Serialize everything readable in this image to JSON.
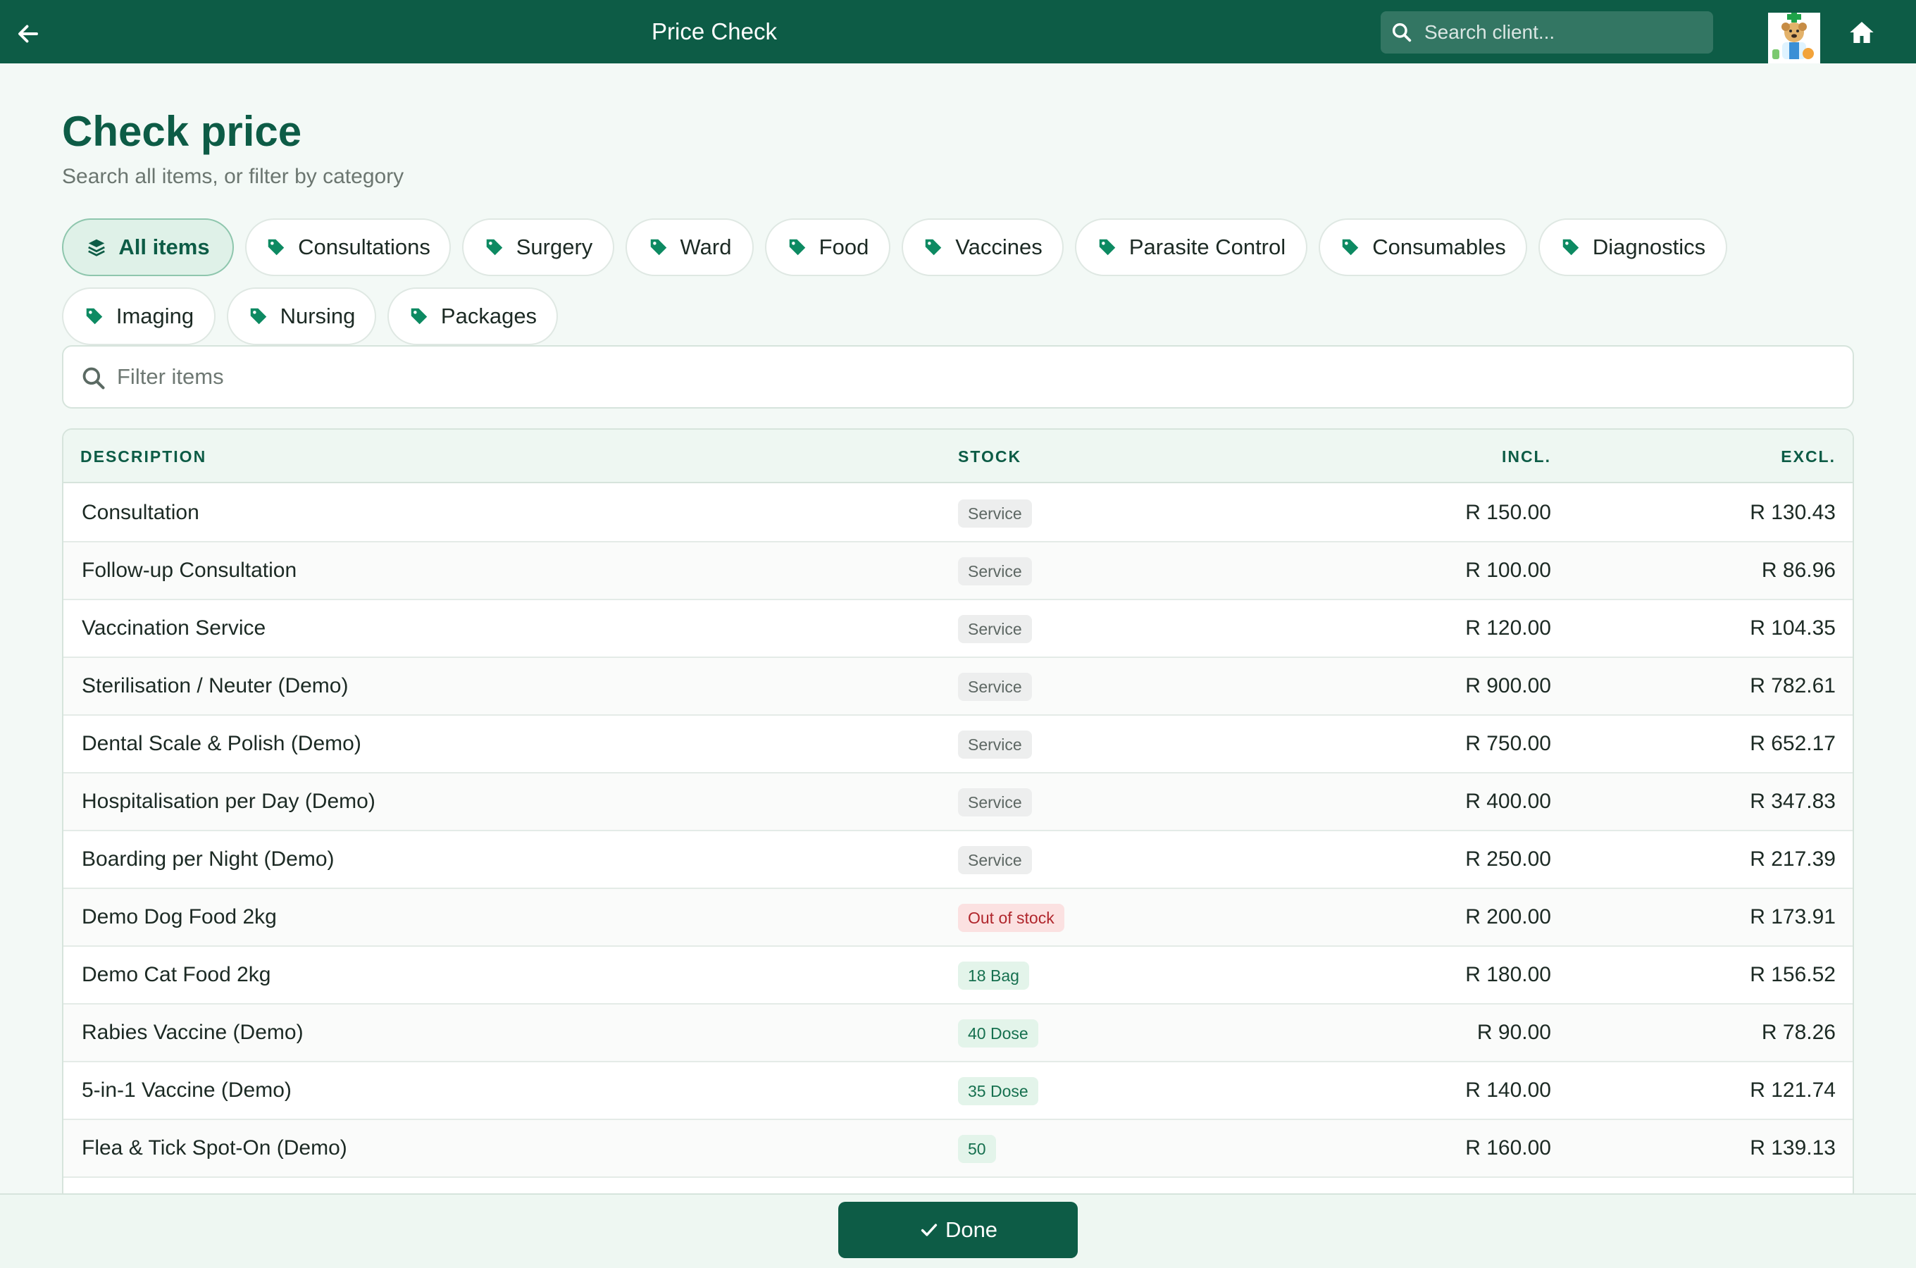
{
  "header": {
    "title": "Price Check",
    "search_placeholder": "Search client...",
    "back_icon": "arrow-left-icon",
    "home_icon": "home-icon",
    "brand_color": "#0d5c46"
  },
  "page": {
    "title": "Check price",
    "subtitle": "Search all items, or filter by category"
  },
  "categories": [
    {
      "label": "All items",
      "icon": "layers-icon",
      "active": true
    },
    {
      "label": "Consultations",
      "icon": "tag-icon"
    },
    {
      "label": "Surgery",
      "icon": "tag-icon"
    },
    {
      "label": "Ward",
      "icon": "tag-icon"
    },
    {
      "label": "Food",
      "icon": "tag-icon"
    },
    {
      "label": "Vaccines",
      "icon": "tag-icon"
    },
    {
      "label": "Parasite Control",
      "icon": "tag-icon"
    },
    {
      "label": "Consumables",
      "icon": "tag-icon"
    },
    {
      "label": "Diagnostics",
      "icon": "tag-icon"
    },
    {
      "label": "Imaging",
      "icon": "tag-icon"
    },
    {
      "label": "Nursing",
      "icon": "tag-icon"
    },
    {
      "label": "Packages",
      "icon": "tag-icon"
    }
  ],
  "filter": {
    "placeholder": "Filter items",
    "value": ""
  },
  "table": {
    "columns": {
      "description": "DESCRIPTION",
      "stock": "STOCK",
      "incl": "INCL.",
      "excl": "EXCL."
    },
    "rows": [
      {
        "description": "Consultation",
        "stock": "Service",
        "stock_status": "neutral",
        "incl": "R 150.00",
        "excl": "R 130.43"
      },
      {
        "description": "Follow-up Consultation",
        "stock": "Service",
        "stock_status": "neutral",
        "incl": "R 100.00",
        "excl": "R 86.96"
      },
      {
        "description": "Vaccination Service",
        "stock": "Service",
        "stock_status": "neutral",
        "incl": "R 120.00",
        "excl": "R 104.35"
      },
      {
        "description": "Sterilisation / Neuter (Demo)",
        "stock": "Service",
        "stock_status": "neutral",
        "incl": "R 900.00",
        "excl": "R 782.61"
      },
      {
        "description": "Dental Scale & Polish (Demo)",
        "stock": "Service",
        "stock_status": "neutral",
        "incl": "R 750.00",
        "excl": "R 652.17"
      },
      {
        "description": "Hospitalisation per Day (Demo)",
        "stock": "Service",
        "stock_status": "neutral",
        "incl": "R 400.00",
        "excl": "R 347.83"
      },
      {
        "description": "Boarding per Night (Demo)",
        "stock": "Service",
        "stock_status": "neutral",
        "incl": "R 250.00",
        "excl": "R 217.39"
      },
      {
        "description": "Demo Dog Food 2kg",
        "stock": "Out of stock",
        "stock_status": "danger",
        "incl": "R 200.00",
        "excl": "R 173.91"
      },
      {
        "description": "Demo Cat Food 2kg",
        "stock": "18 Bag",
        "stock_status": "ok",
        "incl": "R 180.00",
        "excl": "R 156.52"
      },
      {
        "description": "Rabies Vaccine (Demo)",
        "stock": "40 Dose",
        "stock_status": "ok",
        "incl": "R 90.00",
        "excl": "R 78.26"
      },
      {
        "description": "5-in-1 Vaccine (Demo)",
        "stock": "35 Dose",
        "stock_status": "ok",
        "incl": "R 140.00",
        "excl": "R 121.74"
      },
      {
        "description": "Flea & Tick Spot-On (Demo)",
        "stock": "50",
        "stock_status": "ok",
        "incl": "R 160.00",
        "excl": "R 139.13"
      }
    ]
  },
  "footer": {
    "done_label": "Done",
    "done_icon": "check-icon"
  }
}
